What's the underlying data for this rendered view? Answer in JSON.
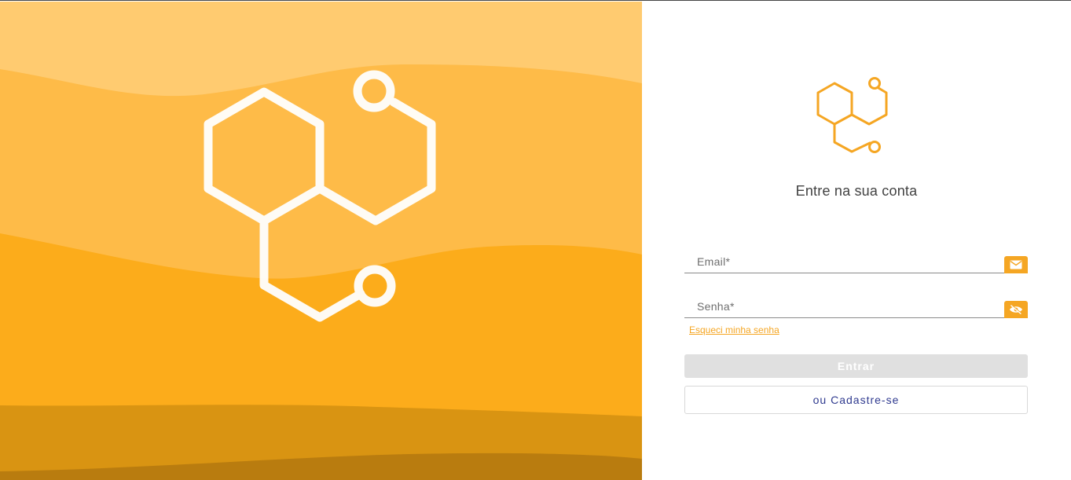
{
  "brand": {
    "accent": "#f5a623",
    "logo": "hexagon-molecule-logo"
  },
  "hero": {
    "bands": [
      "#ffcb70",
      "#febb48",
      "#fcac1b",
      "#d99412",
      "#b97c0f"
    ]
  },
  "login": {
    "title": "Entre na sua conta",
    "email_label": "Email*",
    "email_icon": "mail-icon",
    "password_label": "Senha*",
    "password_icon": "eye-off-icon",
    "forgot_link": "Esqueci minha senha",
    "submit_label": "Entrar",
    "register_label": "ou Cadastre-se"
  }
}
